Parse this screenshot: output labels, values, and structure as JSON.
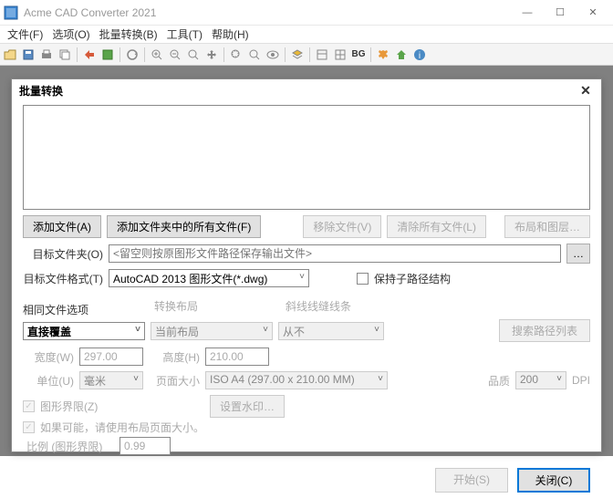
{
  "titlebar": {
    "title": "Acme CAD Converter 2021"
  },
  "menu": {
    "file": "文件(F)",
    "options": "选项(O)",
    "batch": "批量转换(B)",
    "tools": "工具(T)",
    "help": "帮助(H)"
  },
  "toolbar": {
    "bg": "BG"
  },
  "dialog": {
    "title": "批量转换",
    "addFile": "添加文件(A)",
    "addFolder": "添加文件夹中的所有文件(F)",
    "removeFile": "移除文件(V)",
    "clearAll": "清除所有文件(L)",
    "layoutPic": "布局和图层…",
    "targetFolderLabel": "目标文件夹(O)",
    "targetFolderPlaceholder": "<留空则按原图形文件路径保存输出文件>",
    "browse": "…",
    "targetFormatLabel": "目标文件格式(T)",
    "targetFormat": "AutoCAD 2013 图形文件(*.dwg)",
    "keepSubfolders": "保持子路径结构",
    "sameFileLabel": "相同文件选项",
    "convertLayout": "转换布局",
    "lineMode": "斜线线缝线条",
    "sameFileOpt": "直接覆盖",
    "layoutOpt": "当前布局",
    "lineOpt": "从不",
    "searchPath": "搜索路径列表",
    "widthLabel": "宽度(W)",
    "widthVal": "297.00",
    "heightLabel": "高度(H)",
    "heightVal": "210.00",
    "unitLabel": "单位(U)",
    "unitVal": "毫米",
    "pageSizeLabel": "页面大小",
    "pageSize": "ISO A4 (297.00 x 210.00 MM)",
    "qualityLabel": "品质",
    "qualityVal": "200",
    "dpi": "DPI",
    "limitCheck": "图形界限(Z)",
    "useLayoutCheck": "如果可能，请使用布局页面大小。",
    "setWatermark": "设置水印…",
    "ratioLabel": "比例 (图形界限)",
    "ratioVal": "0.99",
    "start": "开始(S)",
    "close": "关闭(C)"
  }
}
